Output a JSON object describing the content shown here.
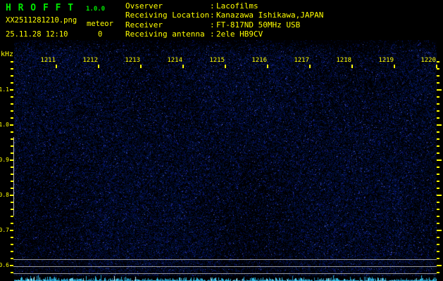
{
  "header": {
    "title": "H R O F F T",
    "version": "1.0.0",
    "filename": "XX2511281210.png",
    "mode": "meteor",
    "datetime": "25.11.28 12:10",
    "meteor_count": "0",
    "sep": ":"
  },
  "station": {
    "rows": [
      {
        "label": "Ovserver",
        "value": "Lacofilms"
      },
      {
        "label": "Receiving Location",
        "value": "Kanazawa Ishikawa,JAPAN"
      },
      {
        "label": "Receiver",
        "value": "FT-817ND 50MHz USB"
      },
      {
        "label": "Receiving antenna",
        "value": "2ele HB9CV"
      }
    ]
  },
  "axis": {
    "freq_unit": "kHz",
    "freq_labels": [
      "1.1",
      "1.0",
      "0.9",
      "0.8",
      "0.7",
      "0.6"
    ],
    "time_labels": [
      "1211",
      "1212",
      "1213",
      "1214",
      "1215",
      "1216",
      "1217",
      "1218",
      "1219",
      "1220"
    ]
  },
  "colors": {
    "title_green": "#00e800",
    "text_yellow": "#ffff00",
    "grid_gray": "#9a9a9a",
    "marker_gray": "#b4b4b4",
    "noise_blue": "#1428a0",
    "strip_cyan": "#32c8e6",
    "background": "#000000"
  }
}
